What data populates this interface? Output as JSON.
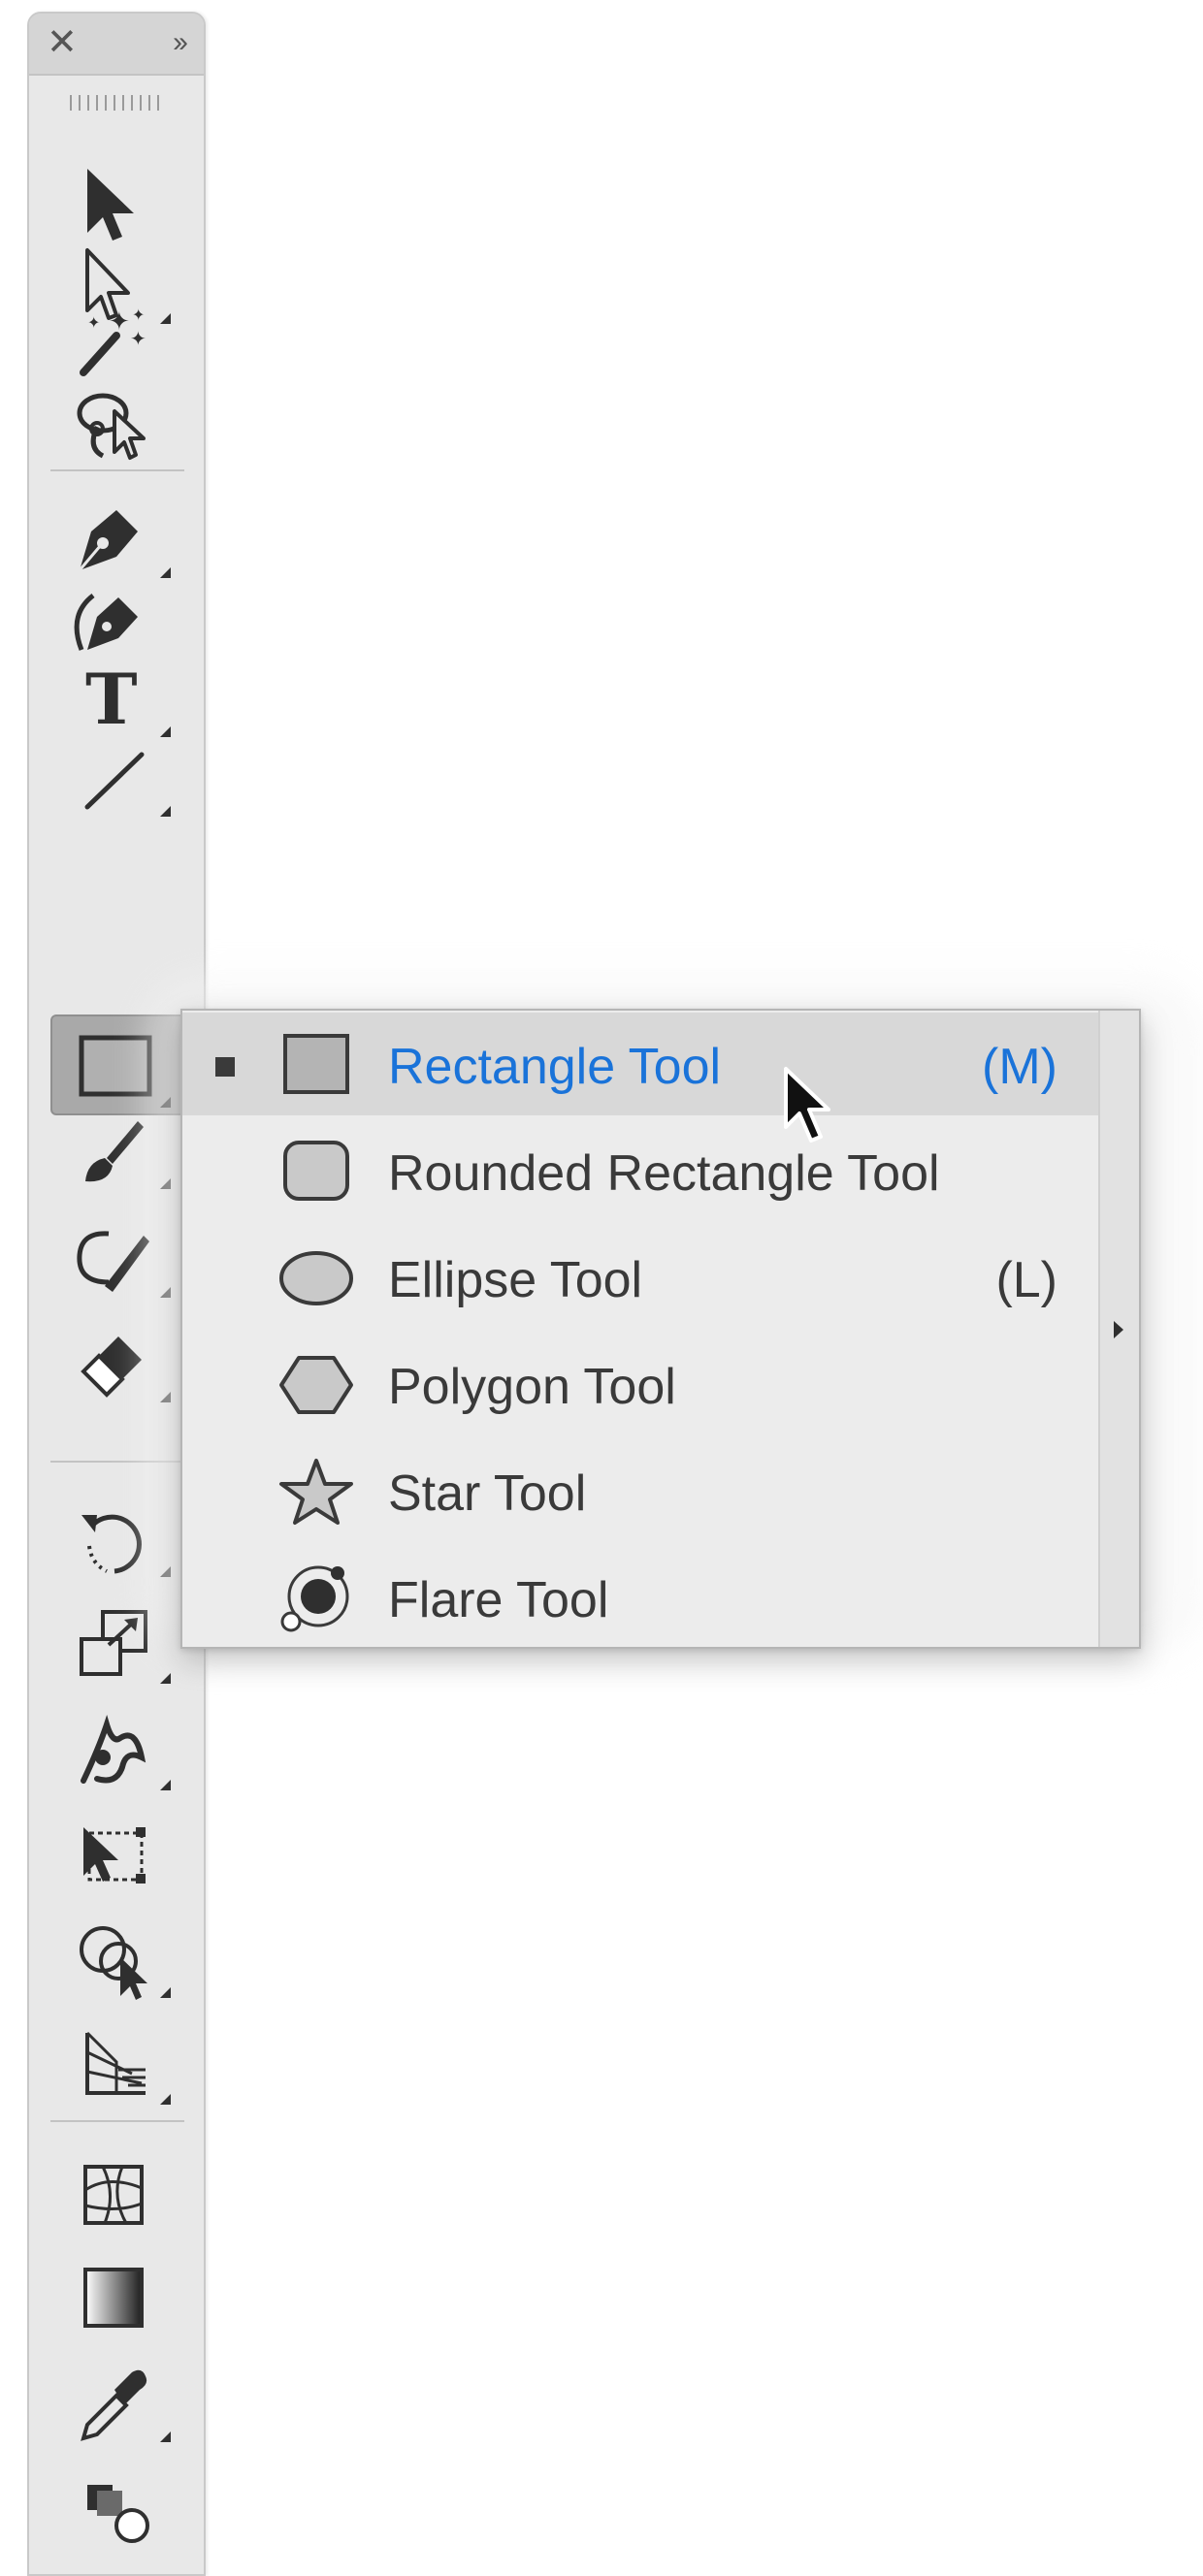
{
  "toolbar": {
    "close_icon": "close-icon",
    "expand_icon": "double-chevron-right-icon",
    "tools": [
      {
        "icon": "selection-arrow-icon"
      },
      {
        "icon": "direct-selection-icon"
      },
      {
        "icon": "magic-wand-icon"
      },
      {
        "icon": "lasso-icon"
      },
      {
        "icon": "pen-icon"
      },
      {
        "icon": "curvature-pen-icon"
      },
      {
        "icon": "type-icon",
        "glyph": "T"
      },
      {
        "icon": "line-segment-icon"
      },
      {
        "icon": "rectangle-icon"
      },
      {
        "icon": "paintbrush-icon"
      },
      {
        "icon": "shaper-icon"
      },
      {
        "icon": "eraser-icon"
      },
      {
        "icon": "rotate-icon"
      },
      {
        "icon": "scale-icon"
      },
      {
        "icon": "warp-icon"
      },
      {
        "icon": "free-transform-icon"
      },
      {
        "icon": "shape-builder-icon"
      },
      {
        "icon": "perspective-grid-icon"
      },
      {
        "icon": "mesh-icon"
      },
      {
        "icon": "gradient-icon"
      },
      {
        "icon": "eyedropper-icon"
      },
      {
        "icon": "blend-icon"
      }
    ],
    "active_tool": "rectangle-icon"
  },
  "flyout": {
    "items": [
      {
        "label": "Rectangle Tool",
        "shortcut": "(M)",
        "icon": "rectangle-shape-icon",
        "selected": true
      },
      {
        "label": "Rounded Rectangle Tool",
        "shortcut": "",
        "icon": "rounded-rectangle-icon",
        "selected": false
      },
      {
        "label": "Ellipse Tool",
        "shortcut": "(L)",
        "icon": "ellipse-icon",
        "selected": false
      },
      {
        "label": "Polygon Tool",
        "shortcut": "",
        "icon": "polygon-icon",
        "selected": false
      },
      {
        "label": "Star Tool",
        "shortcut": "",
        "icon": "star-icon",
        "selected": false
      },
      {
        "label": "Flare Tool",
        "shortcut": "",
        "icon": "flare-icon",
        "selected": false
      }
    ],
    "submenu_arrow_icon": "tearoff-arrow-icon"
  },
  "colors": {
    "selected_text": "#1a73d9",
    "panel_bg": "#e8e8e8",
    "icon": "#2f2f2f"
  }
}
